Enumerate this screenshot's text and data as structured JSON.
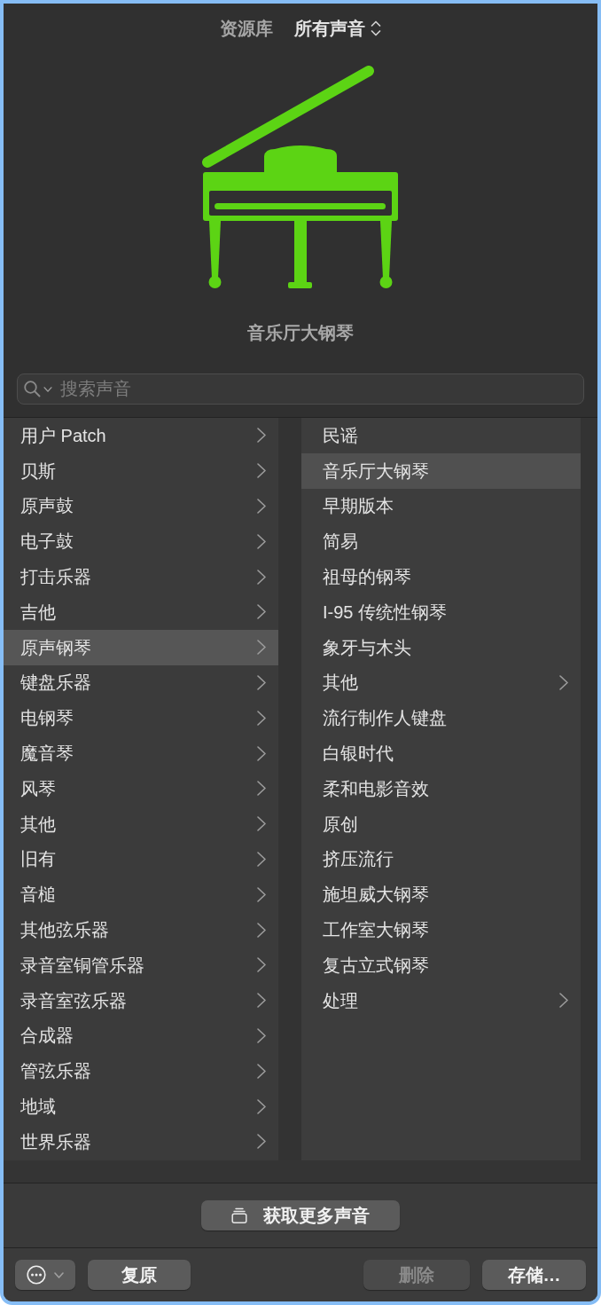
{
  "header": {
    "label": "资源库",
    "filter": "所有声音"
  },
  "patch": {
    "name": "音乐厅大钢琴"
  },
  "search": {
    "placeholder": "搜索声音"
  },
  "categories": [
    {
      "label": "用户 Patch",
      "selected": false
    },
    {
      "label": "贝斯",
      "selected": false
    },
    {
      "label": "原声鼓",
      "selected": false
    },
    {
      "label": "电子鼓",
      "selected": false
    },
    {
      "label": "打击乐器",
      "selected": false
    },
    {
      "label": "吉他",
      "selected": false
    },
    {
      "label": "原声钢琴",
      "selected": true
    },
    {
      "label": "键盘乐器",
      "selected": false
    },
    {
      "label": "电钢琴",
      "selected": false
    },
    {
      "label": "魔音琴",
      "selected": false
    },
    {
      "label": "风琴",
      "selected": false
    },
    {
      "label": "其他",
      "selected": false
    },
    {
      "label": "旧有",
      "selected": false
    },
    {
      "label": "音槌",
      "selected": false
    },
    {
      "label": "其他弦乐器",
      "selected": false
    },
    {
      "label": "录音室铜管乐器",
      "selected": false
    },
    {
      "label": "录音室弦乐器",
      "selected": false
    },
    {
      "label": "合成器",
      "selected": false
    },
    {
      "label": "管弦乐器",
      "selected": false
    },
    {
      "label": "地域",
      "selected": false
    },
    {
      "label": "世界乐器",
      "selected": false
    }
  ],
  "patches": [
    {
      "label": "民谣",
      "kind": "patch",
      "selected": false
    },
    {
      "label": "音乐厅大钢琴",
      "kind": "patch",
      "selected": true
    },
    {
      "label": "早期版本",
      "kind": "patch",
      "selected": false
    },
    {
      "label": "简易",
      "kind": "patch",
      "selected": false
    },
    {
      "label": "祖母的钢琴",
      "kind": "patch",
      "selected": false
    },
    {
      "label": "I-95 传统性钢琴",
      "kind": "patch",
      "selected": false
    },
    {
      "label": "象牙与木头",
      "kind": "patch",
      "selected": false
    },
    {
      "label": "其他",
      "kind": "folder",
      "selected": false
    },
    {
      "label": "流行制作人键盘",
      "kind": "patch",
      "selected": false
    },
    {
      "label": "白银时代",
      "kind": "patch",
      "selected": false
    },
    {
      "label": "柔和电影音效",
      "kind": "patch",
      "selected": false
    },
    {
      "label": "原创",
      "kind": "patch",
      "selected": false
    },
    {
      "label": "挤压流行",
      "kind": "patch",
      "selected": false
    },
    {
      "label": "施坦威大钢琴",
      "kind": "patch",
      "selected": false
    },
    {
      "label": "工作室大钢琴",
      "kind": "patch",
      "selected": false
    },
    {
      "label": "复古立式钢琴",
      "kind": "patch",
      "selected": false
    },
    {
      "label": "处理",
      "kind": "folder",
      "selected": false
    }
  ],
  "get_more": {
    "label": "获取更多声音"
  },
  "footer": {
    "revert": {
      "label": "复原",
      "disabled": false
    },
    "delete": {
      "label": "删除",
      "disabled": true
    },
    "save": {
      "label": "存储…",
      "disabled": false
    }
  }
}
